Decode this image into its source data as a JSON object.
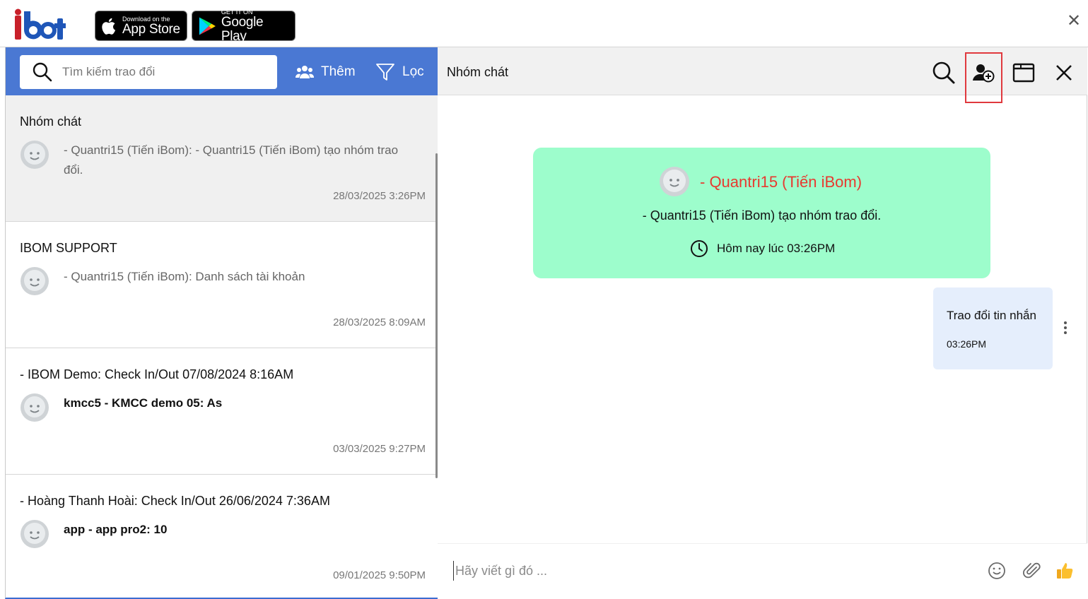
{
  "top": {
    "logo_text": "ibot",
    "app_store": {
      "small": "Download on the",
      "big": "App Store"
    },
    "google_play": {
      "small": "GET IT ON",
      "big": "Google Play"
    },
    "close_icon": "close-icon"
  },
  "left": {
    "search_placeholder": "Tìm kiếm trao đổi",
    "add_label": "Thêm",
    "filter_label": "Lọc",
    "conversations": [
      {
        "title": "Nhóm chát",
        "message": "- Quantri15 (Tiến iBom): - Quantri15 (Tiến iBom) tạo nhóm trao đổi.",
        "time": "28/03/2025 3:26PM"
      },
      {
        "title": "IBOM SUPPORT",
        "message": "- Quantri15 (Tiến iBom): Danh sách tài khoản",
        "time": "28/03/2025 8:09AM"
      },
      {
        "title": "- IBOM Demo: Check In/Out 07/08/2024 8:16AM",
        "message": "kmcc5 - KMCC demo 05: As",
        "time": "03/03/2025 9:27PM"
      },
      {
        "title": "- Hoàng Thanh Hoài: Check In/Out 26/06/2024 7:36AM",
        "message": "app - app pro2: 10",
        "time": "09/01/2025 9:50PM"
      }
    ]
  },
  "chat": {
    "title": "Nhóm chát",
    "system": {
      "name": "- Quantri15 (Tiến iBom)",
      "text": "- Quantri15 (Tiến iBom) tạo nhóm trao đổi.",
      "time": "Hôm nay lúc 03:26PM"
    },
    "message": {
      "text": "Trao đổi tin nhắn",
      "time": "03:26PM"
    },
    "compose_placeholder": "Hãy viết gì đó ..."
  },
  "colors": {
    "header_blue": "#4a78d3",
    "system_card": "#9dfdcc",
    "system_name": "#e8392f",
    "bubble": "#e5eefc",
    "highlight": "#e0393e"
  }
}
